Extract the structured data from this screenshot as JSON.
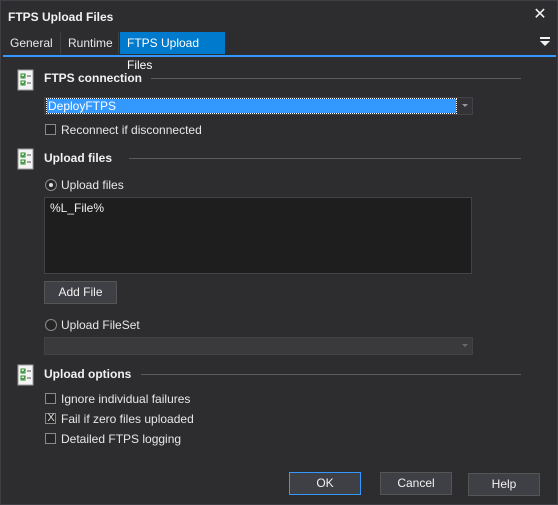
{
  "window": {
    "title": "FTPS Upload Files",
    "close_glyph": "✕"
  },
  "tabs": [
    {
      "label": "General"
    },
    {
      "label": "Runtime"
    },
    {
      "label": "FTPS Upload Files",
      "active": true
    }
  ],
  "connection_section": {
    "title": "FTPS connection",
    "connection_value": "DeployFTPS",
    "reconnect_label": "Reconnect if disconnected",
    "reconnect_checked": false
  },
  "upload_files_section": {
    "title": "Upload files",
    "radio_upload_files_label": "Upload files",
    "radio_upload_files_selected": true,
    "files_text": "%L_File%",
    "add_file_label": "Add File",
    "radio_fileset_label": "Upload FileSet",
    "radio_fileset_selected": false,
    "fileset_value": ""
  },
  "upload_options_section": {
    "title": "Upload options",
    "options": [
      {
        "label": "Ignore individual failures",
        "checked": false
      },
      {
        "label": "Fail if zero files uploaded",
        "checked": true,
        "mark": "X"
      },
      {
        "label": "Detailed FTPS logging",
        "checked": false
      }
    ]
  },
  "footer": {
    "ok_label": "OK",
    "cancel_label": "Cancel",
    "help_label": "Help"
  },
  "colors": {
    "background": "#2d2d30",
    "accent": "#007acc",
    "selection": "#3399ff"
  }
}
